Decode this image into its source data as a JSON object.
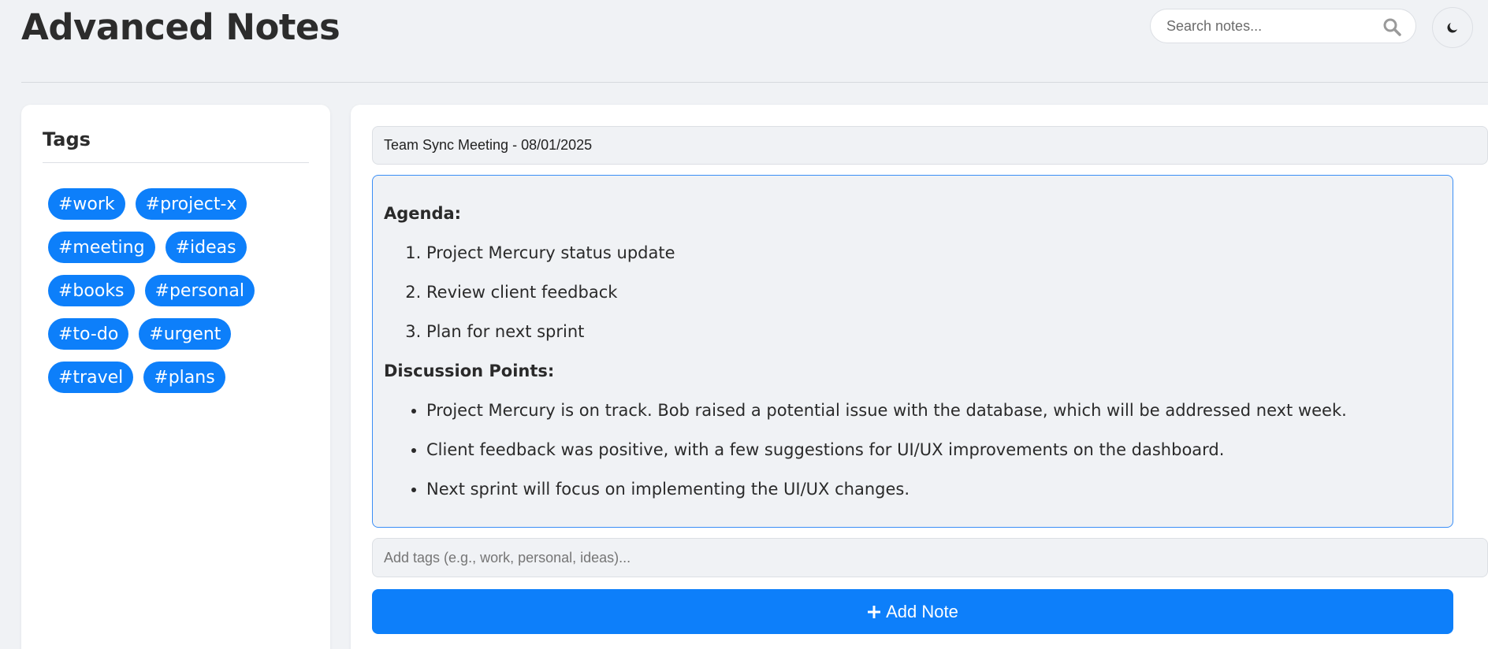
{
  "header": {
    "title": "Advanced Notes",
    "search_placeholder": "Search notes...",
    "search_icon": "search-icon",
    "theme_icon": "moon-icon"
  },
  "sidebar": {
    "heading": "Tags",
    "tags": [
      "#work",
      "#project-x",
      "#meeting",
      "#ideas",
      "#books",
      "#personal",
      "#to-do",
      "#urgent",
      "#travel",
      "#plans"
    ]
  },
  "editor": {
    "title_value": "Team Sync Meeting - 08/01/2025",
    "agenda_heading": "Agenda:",
    "agenda_items": [
      "Project Mercury status update",
      "Review client feedback",
      "Plan for next sprint"
    ],
    "discussion_heading": "Discussion Points:",
    "discussion_items": [
      "Project Mercury is on track. Bob raised a potential issue with the database, which will be addressed next week.",
      "Client feedback was positive, with a few suggestions for UI/UX improvements on the dashboard.",
      "Next sprint will focus on implementing the UI/UX changes."
    ],
    "tags_placeholder": "Add tags (e.g., work, personal, ideas)...",
    "add_button_label": "Add Note",
    "add_icon": "plus-icon"
  },
  "colors": {
    "accent": "#0d7ffa",
    "background": "#f0f2f5"
  }
}
